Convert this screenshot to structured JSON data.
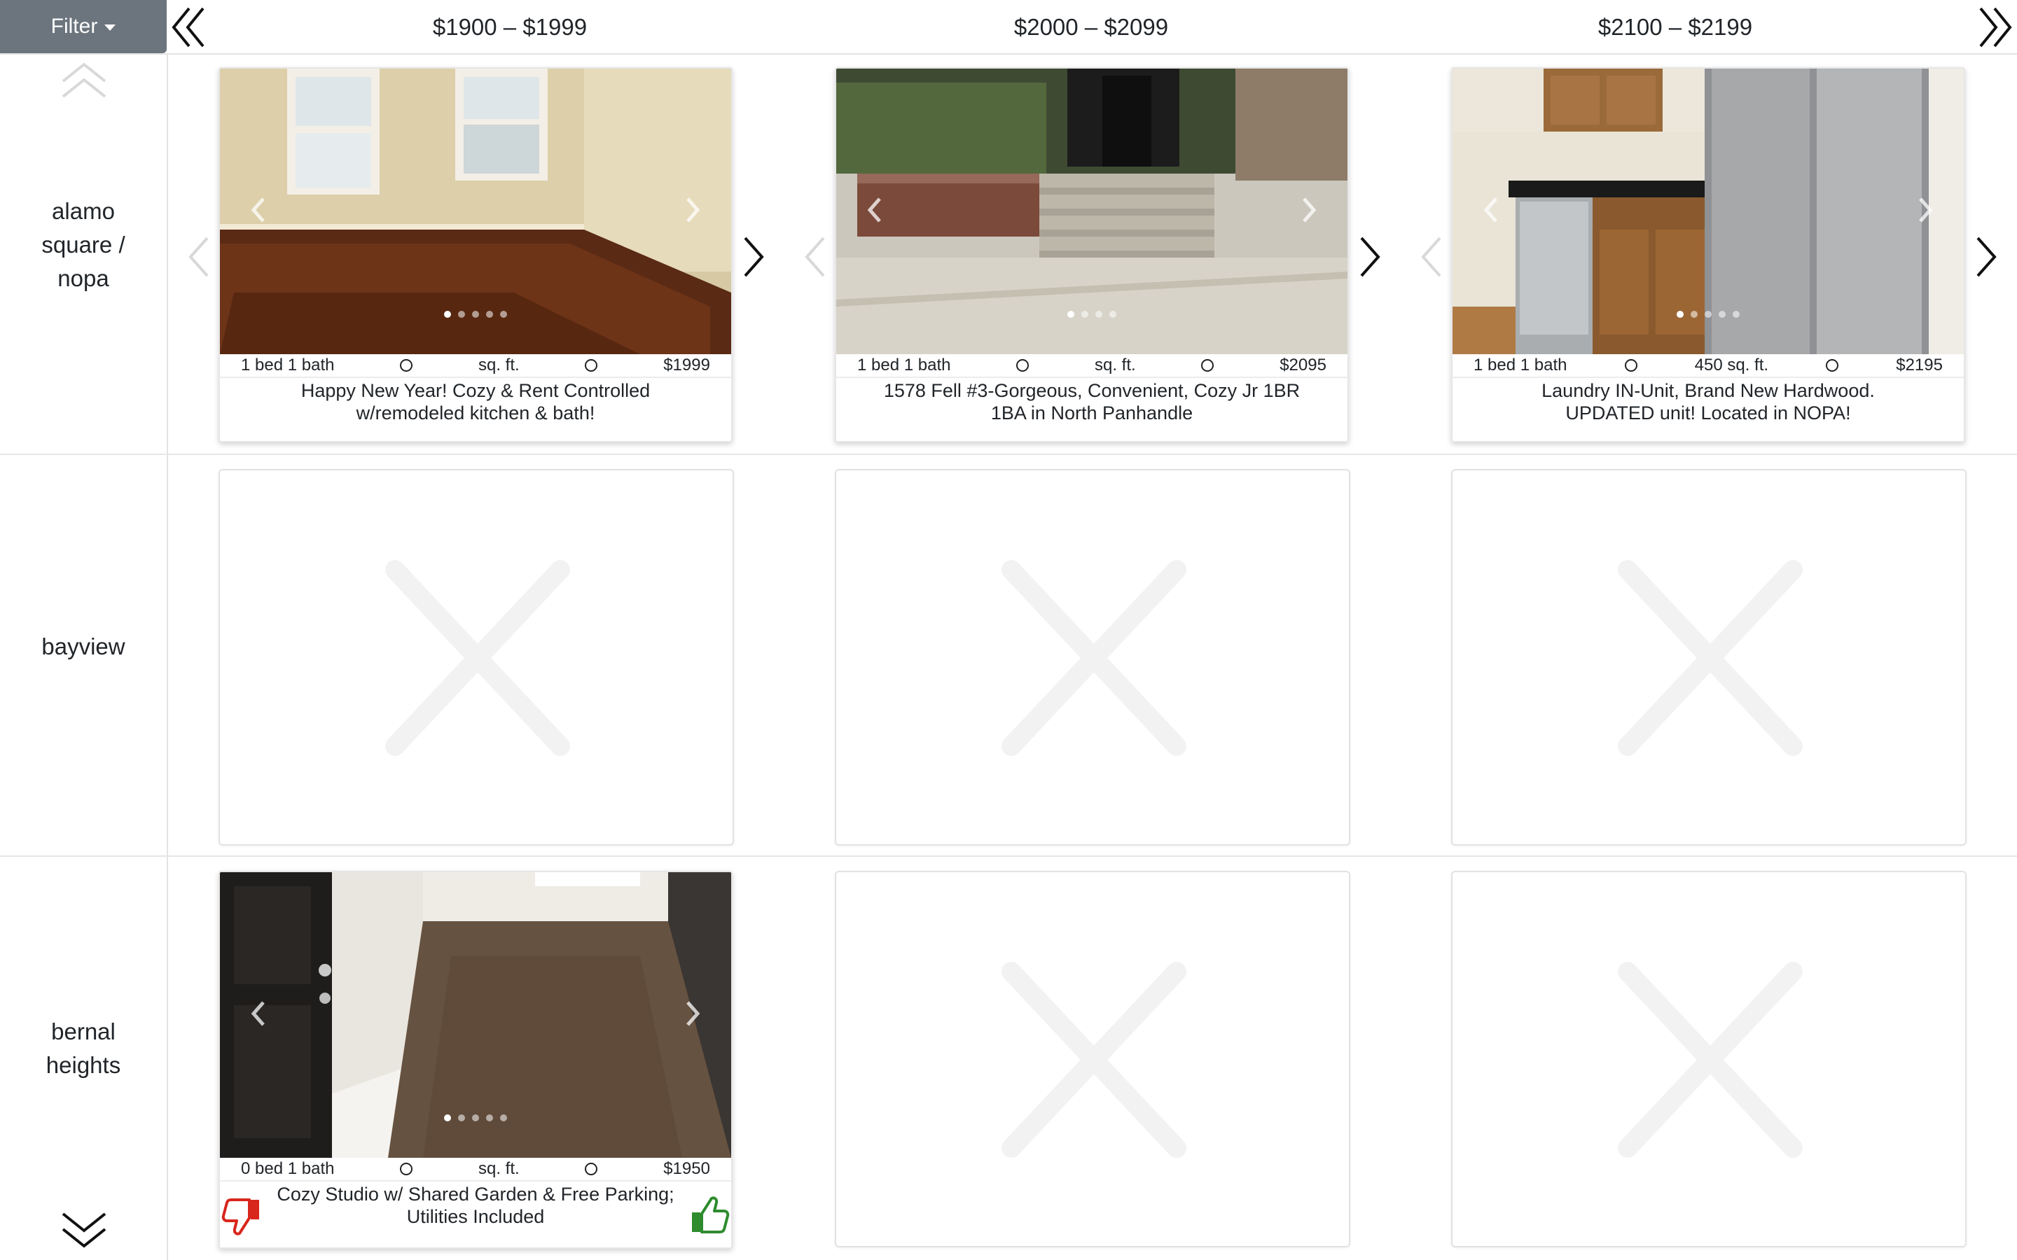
{
  "toolbar": {
    "filter_label": "Filter"
  },
  "columns": [
    {
      "label": "$1900 – $1999"
    },
    {
      "label": "$2000 – $2099"
    },
    {
      "label": "$2100 – $2199"
    }
  ],
  "rows": [
    {
      "label_lines": [
        "alamo",
        "square /",
        "nopa"
      ]
    },
    {
      "label_lines": [
        "bayview"
      ]
    },
    {
      "label_lines": [
        "bernal",
        "heights"
      ]
    }
  ],
  "listings": {
    "r0c0": {
      "beds": "1 bed 1 bath",
      "sqft": "sq. ft.",
      "price": "$1999",
      "title": "Happy New Year! Cozy & Rent Controlled w/remodeled kitchen & bath!"
    },
    "r0c1": {
      "beds": "1 bed 1 bath",
      "sqft": "sq. ft.",
      "price": "$2095",
      "title": "1578 Fell #3-Gorgeous, Convenient, Cozy Jr 1BR 1BA in North Panhandle"
    },
    "r0c2": {
      "beds": "1 bed 1 bath",
      "sqft": "450 sq. ft.",
      "price": "$2195",
      "title": "Laundry IN-Unit, Brand New Hardwood. UPDATED unit! Located in NOPA!"
    },
    "r2c0": {
      "beds": "0 bed 1 bath",
      "sqft": "sq. ft.",
      "price": "$1950",
      "title": "Cozy Studio w/ Shared Garden & Free Parking; Utilities Included"
    }
  },
  "icons": {
    "first": "double-chevron-left-icon",
    "last": "double-chevron-right-icon",
    "up": "double-chevron-up-icon",
    "down": "double-chevron-down-icon",
    "thumbs_down": "thumbs-down-icon",
    "thumbs_up": "thumbs-up-icon",
    "empty": "x-placeholder-icon"
  },
  "colors": {
    "filter_bg": "#6c757d",
    "thumbs_down": "#d9261c",
    "thumbs_up": "#2e8b2e",
    "placeholder_x": "#f2f2f2"
  }
}
